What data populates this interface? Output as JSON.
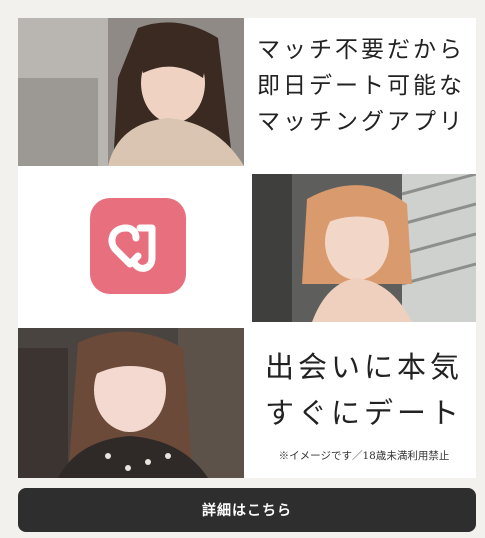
{
  "headline": {
    "lines": [
      "マッチ不要だから",
      "即日デート可能な",
      "マッチングアプリ"
    ]
  },
  "tagline": {
    "lines": [
      "出会いに本気",
      "すぐにデート"
    ]
  },
  "disclaimer": "※イメージです／18歳未満利用禁止",
  "cta": {
    "label": "詳細はこちら"
  },
  "logo": {
    "icon": "app-logo-icon",
    "color": "#e8707e"
  },
  "colors": {
    "background": "#f3f1ee",
    "button": "#2e2e2e"
  }
}
